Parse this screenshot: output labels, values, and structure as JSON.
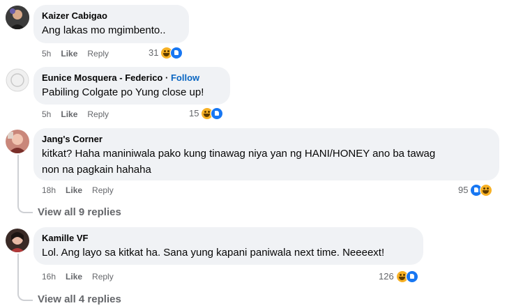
{
  "comments": [
    {
      "author": "Kaizer Cabigao",
      "text": "Ang lakas mo mgimbento..",
      "time": "5h",
      "like_label": "Like",
      "reply_label": "Reply",
      "reaction_count": "31",
      "reactions": [
        "haha-icon",
        "like-icon"
      ]
    },
    {
      "author": "Eunice Mosquera - Federico",
      "follow_sep": "·",
      "follow_label": "Follow",
      "text": "Pabiling Colgate po Yung close up!",
      "time": "5h",
      "like_label": "Like",
      "reply_label": "Reply",
      "reaction_count": "15",
      "reactions": [
        "haha-icon",
        "like-icon"
      ]
    },
    {
      "author": "Jang's Corner",
      "text_line1": "kitkat? Haha maniniwala pako kung tinawag niya yan ng HANI/HONEY ano ba tawag",
      "text_line2": "non na pagkain hahaha",
      "time": "18h",
      "like_label": "Like",
      "reply_label": "Reply",
      "reaction_count": "95",
      "reactions": [
        "like-icon",
        "haha-icon"
      ],
      "view_replies": "View all 9 replies"
    },
    {
      "author": "Kamille VF",
      "text": "Lol. Ang layo sa kitkat ha. Sana yung kapani paniwala next time. Neeeext!",
      "time": "16h",
      "like_label": "Like",
      "reply_label": "Reply",
      "reaction_count": "126",
      "reactions": [
        "haha-icon",
        "like-icon"
      ],
      "view_replies": "View all 4 replies"
    }
  ],
  "colors": {
    "bubble": "#f0f2f5",
    "meta": "#65676b",
    "follow": "#0a66c2",
    "like": "#1877f2",
    "haha": "#f7b125"
  }
}
